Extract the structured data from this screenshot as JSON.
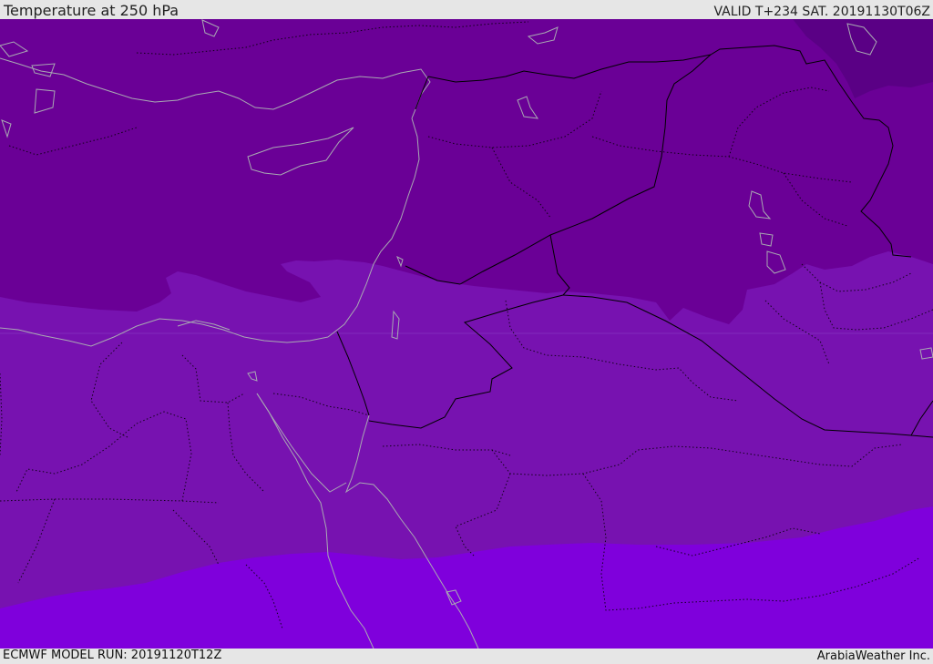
{
  "header": {
    "title": "Temperature at 250 hPa",
    "valid_time": "VALID T+234 SAT. 20191130T06Z"
  },
  "footer": {
    "model_run": "ECMWF MODEL RUN: 20191120T12Z",
    "credit": "ArabiaWeather Inc."
  },
  "map": {
    "variable": "temperature",
    "level": "250 hPa",
    "shading_colors": {
      "coldest": "#5a0085",
      "cold": "#6a0096",
      "mid": "#7712b0",
      "warm": "#7f00dc"
    },
    "coastline_color": "#a9a9b3",
    "border_color": "#000000",
    "internal_border_style": "dotted"
  }
}
